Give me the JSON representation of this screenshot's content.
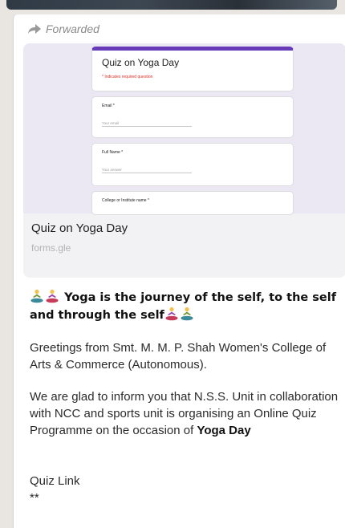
{
  "message": {
    "forwarded_label": "Forwarded",
    "preview": {
      "form": {
        "title": "Quiz on Yoga Day",
        "required_note": "* Indicates required question",
        "fields": [
          {
            "label": "Email *",
            "placeholder": "Your email"
          },
          {
            "label": "Full Name *",
            "placeholder": "Your answer"
          },
          {
            "label": "College or Institute name *"
          }
        ]
      },
      "title": "Quiz on Yoga Day",
      "domain": "forms.gle"
    },
    "headline": "Yoga is the journey of the self, to the self and through the self",
    "para1": "Greetings from Smt. M. M. P. Shah Women's College of Arts & Commerce (Autonomous).",
    "para2_prefix": "We are glad to inform you that N.S.S. Unit in collaboration with NCC and sports unit is organising  an Online Quiz Programme on the occasion of ",
    "para2_bold": "Yoga Day",
    "quiz_link_label": "Quiz Link",
    "trailing_text": "**"
  },
  "colors": {
    "form_accent": "#673ab7",
    "chat_background": "#e9e6e1",
    "bubble": "#ffffff"
  },
  "icons": [
    "forward-arrow-icon",
    "yoga-person-emoji"
  ]
}
